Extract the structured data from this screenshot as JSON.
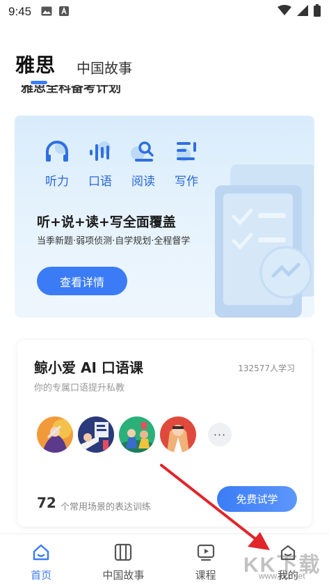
{
  "status_bar": {
    "time": "9:45"
  },
  "top_tabs": [
    {
      "label": "雅思",
      "active": true
    },
    {
      "label": "中国故事",
      "active": false
    }
  ],
  "section_title": "雅思全科备考计划",
  "hero": {
    "skills": [
      {
        "label": "听力",
        "icon": "headphones-icon"
      },
      {
        "label": "口语",
        "icon": "voice-wave-icon"
      },
      {
        "label": "阅读",
        "icon": "reading-icon"
      },
      {
        "label": "写作",
        "icon": "writing-icon"
      }
    ],
    "headline": "听+说+读+写全面覆盖",
    "subline": "当季新题·弱项侦测·自学规划·全程督学",
    "button": "查看详情"
  },
  "ai_course": {
    "title": "鲸小爱 AI 口语课",
    "learners": "132577人学习",
    "subtitle": "你的专属口语提升私教",
    "more": "···",
    "scenario_count": "72",
    "scenario_text": "个常用场景的表达训练",
    "button": "免费试学"
  },
  "bottom_nav": [
    {
      "label": "首页",
      "icon": "home-icon",
      "active": true
    },
    {
      "label": "中国故事",
      "icon": "book-icon",
      "active": false
    },
    {
      "label": "课程",
      "icon": "play-icon",
      "active": false
    },
    {
      "label": "我的",
      "icon": "profile-icon",
      "active": false
    }
  ],
  "watermark": {
    "text": "KK下载",
    "url": "www.kkx.net"
  },
  "colors": {
    "accent": "#3b7cf6",
    "annotation_arrow": "#e0252b"
  }
}
